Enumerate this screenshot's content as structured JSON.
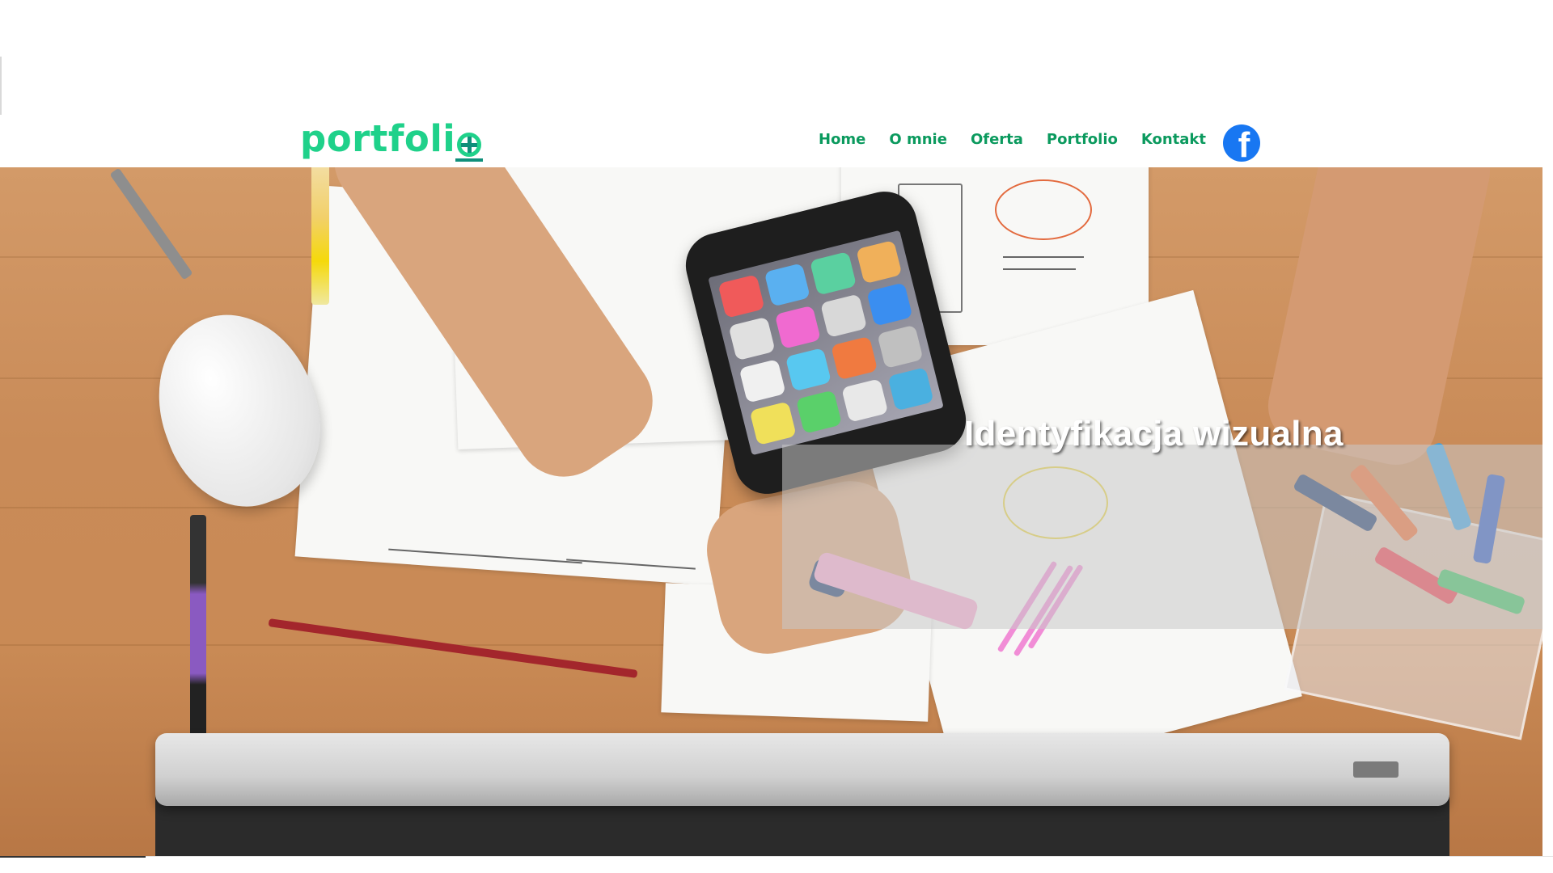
{
  "header": {
    "logo_text": "portfoli",
    "logo_icon": "plus-circle-icon",
    "nav": [
      {
        "label": "Home"
      },
      {
        "label": "O mnie"
      },
      {
        "label": "Oferta"
      },
      {
        "label": "Portfolio"
      },
      {
        "label": "Kontakt"
      }
    ],
    "social_icon": "facebook-icon"
  },
  "hero": {
    "title": "Identyfikacja wizualna"
  },
  "colors": {
    "brand_green": "#1fd18a",
    "nav_green": "#0b9a5e",
    "facebook_blue": "#1877f2"
  }
}
